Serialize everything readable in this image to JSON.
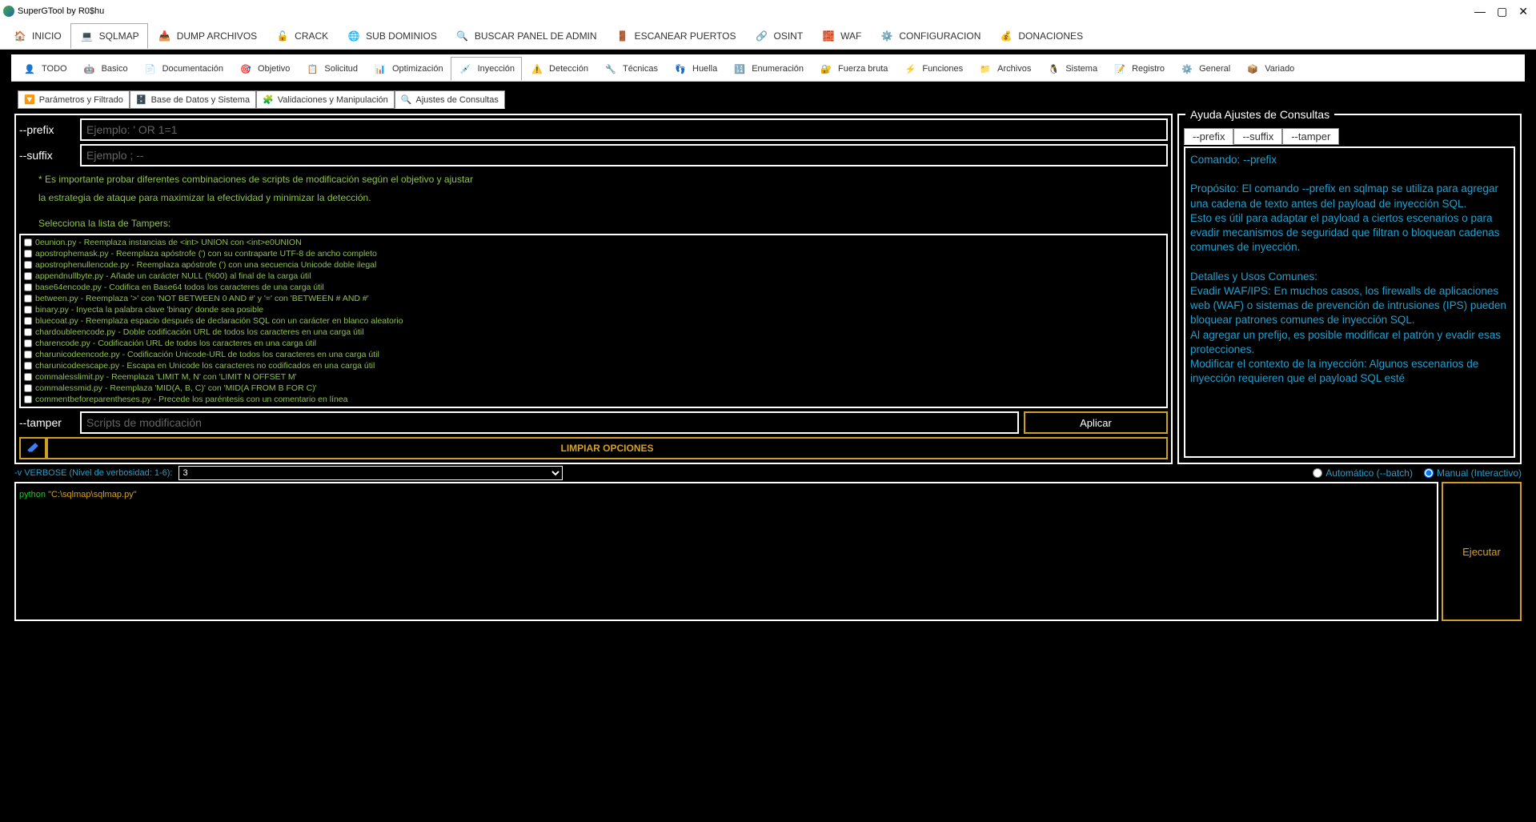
{
  "titlebar": {
    "title": "SuperGTool by R0$hu"
  },
  "main_tabs": [
    {
      "label": "INICIO"
    },
    {
      "label": "SQLMAP",
      "active": true
    },
    {
      "label": "DUMP ARCHIVOS"
    },
    {
      "label": "CRACK"
    },
    {
      "label": "SUB DOMINIOS"
    },
    {
      "label": "BUSCAR PANEL DE ADMIN"
    },
    {
      "label": "ESCANEAR PUERTOS"
    },
    {
      "label": "OSINT"
    },
    {
      "label": "WAF"
    },
    {
      "label": "CONFIGURACION"
    },
    {
      "label": "DONACIONES"
    }
  ],
  "sub_tabs": [
    {
      "label": "TODO"
    },
    {
      "label": "Basico"
    },
    {
      "label": "Documentación"
    },
    {
      "label": "Objetivo"
    },
    {
      "label": "Solicitud"
    },
    {
      "label": "Optimización"
    },
    {
      "label": "Inyección",
      "active": true
    },
    {
      "label": "Detección"
    },
    {
      "label": "Técnicas"
    },
    {
      "label": "Huella"
    },
    {
      "label": "Enumeración"
    },
    {
      "label": "Fuerza bruta"
    },
    {
      "label": "Funciones"
    },
    {
      "label": "Archivos"
    },
    {
      "label": "Sistema"
    },
    {
      "label": "Registro"
    },
    {
      "label": "General"
    },
    {
      "label": "Variado"
    }
  ],
  "sub_sub_tabs": [
    {
      "label": "Parámetros y Filtrado"
    },
    {
      "label": "Base de Datos y Sistema"
    },
    {
      "label": "Validaciones y Manipulación"
    },
    {
      "label": "Ajustes de Consultas",
      "active": true
    }
  ],
  "form": {
    "prefix_label": "--prefix",
    "prefix_placeholder": "Ejemplo: ' OR 1=1",
    "suffix_label": "--suffix",
    "suffix_placeholder": "Ejemplo ; --",
    "hint_l1": "* Es importante probar diferentes combinaciones de scripts de modificación según el objetivo y ajustar",
    "hint_l2": "la estrategia de ataque para maximizar la efectividad y minimizar la detección.",
    "tampers_label": "Selecciona la lista de Tampers:",
    "tamper_label": "--tamper",
    "tamper_placeholder": "Scripts de modificación",
    "apply_btn": "Aplicar",
    "clear_btn": "LIMPIAR OPCIONES"
  },
  "tampers": [
    "0eunion.py - Reemplaza instancias de <int> UNION con <int>e0UNION",
    "apostrophemask.py - Reemplaza apóstrofe (') con su contraparte UTF-8 de ancho completo",
    "apostrophenullencode.py - Reemplaza apóstrofe (') con una secuencia Unicode doble ilegal",
    "appendnullbyte.py - Añade un carácter NULL (%00) al final de la carga útil",
    "base64encode.py - Codifica en Base64 todos los caracteres de una carga útil",
    "between.py - Reemplaza '>' con 'NOT BETWEEN 0 AND #' y '=' con 'BETWEEN # AND #'",
    "binary.py - Inyecta la palabra clave 'binary' donde sea posible",
    "bluecoat.py - Reemplaza espacio después de declaración SQL con un carácter en blanco aleatorio",
    "chardoubleencode.py - Doble codificación URL de todos los caracteres en una carga útil",
    "charencode.py - Codificación URL de todos los caracteres en una carga útil",
    "charunicodeencode.py - Codificación Unicode-URL de todos los caracteres en una carga útil",
    "charunicodeescape.py - Escapa en Unicode los caracteres no codificados en una carga útil",
    "commalesslimit.py - Reemplaza 'LIMIT M, N' con 'LIMIT N OFFSET M'",
    "commalessmid.py - Reemplaza 'MID(A, B, C)' con 'MID(A FROM B FOR C)'",
    "commentbeforeparentheses.py - Precede los paréntesis con un comentario en línea"
  ],
  "help": {
    "title": "Ayuda Ajustes de Consultas",
    "tabs": [
      {
        "label": "--prefix",
        "active": true
      },
      {
        "label": "--suffix"
      },
      {
        "label": "--tamper"
      }
    ],
    "body": "Comando: --prefix\n\nPropósito: El comando --prefix en sqlmap se utiliza para agregar una cadena de texto antes del payload de inyección SQL.\nEsto es útil para adaptar el payload a ciertos escenarios o para evadir mecanismos de seguridad que filtran o bloquean cadenas comunes de inyección.\n\nDetalles y Usos Comunes:\nEvadir WAF/IPS: En muchos casos, los firewalls de aplicaciones web (WAF) o sistemas de prevención de intrusiones (IPS) pueden bloquear patrones comunes de inyección SQL.\nAl agregar un prefijo, es posible modificar el patrón y evadir esas protecciones.\nModificar el contexto de la inyección: Algunos escenarios de inyección requieren que el payload SQL esté"
  },
  "bottom": {
    "verbose_label": "-v VERBOSE (Nivel de verbosidad: 1-6):",
    "verbose_value": "3",
    "auto_label": "Automático (--batch)",
    "manual_label": "Manual (Interactivo)",
    "manual_selected": true
  },
  "console": {
    "prefix": "python ",
    "path": "\"C:\\sqlmap\\sqlmap.py\""
  },
  "execute_btn": "Ejecutar"
}
